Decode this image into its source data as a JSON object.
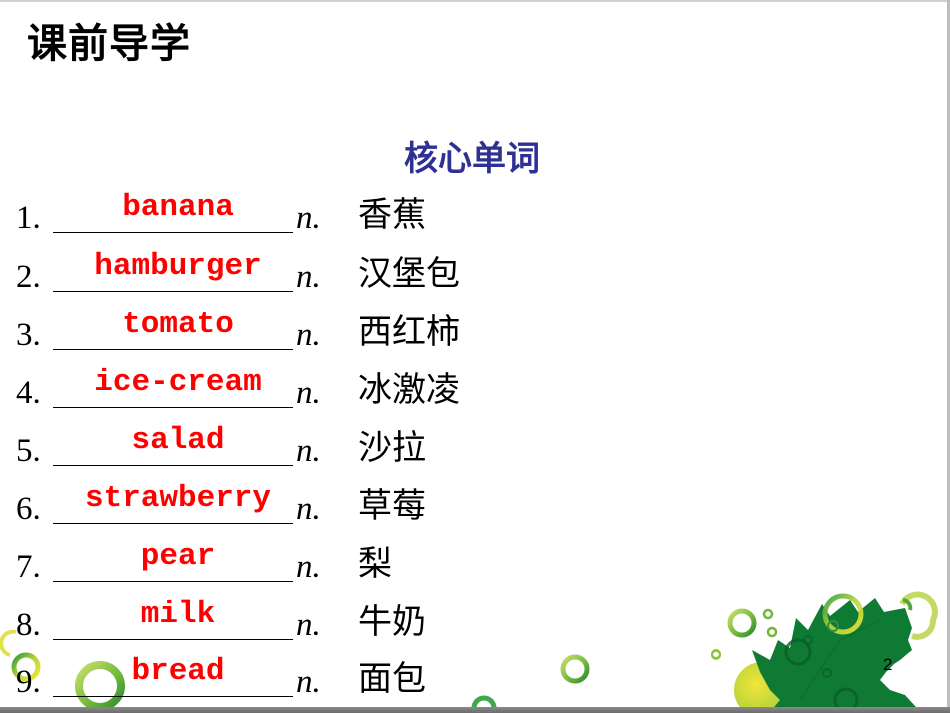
{
  "slide": {
    "title": "课前导学",
    "section_heading": "核心单词",
    "page_number": "2",
    "colors": {
      "title": "#000000",
      "section_heading": "#2e3192",
      "answer": "#ff0000",
      "leaf_dark": "#0e7a33",
      "ring_light": "#a8cf45",
      "ring_yellow": "#e6e332"
    },
    "vocabulary": [
      {
        "number": "1.",
        "answer": "banana",
        "pos": "n.",
        "meaning": "香蕉"
      },
      {
        "number": "2.",
        "answer": "hamburger",
        "pos": "n.",
        "meaning": "汉堡包"
      },
      {
        "number": "3.",
        "answer": "tomato",
        "pos": "n.",
        "meaning": "西红柿"
      },
      {
        "number": "4.",
        "answer": "ice-cream",
        "pos": "n.",
        "meaning": "冰激凌"
      },
      {
        "number": "5.",
        "answer": "salad",
        "pos": "n.",
        "meaning": "沙拉"
      },
      {
        "number": "6.",
        "answer": "strawberry",
        "pos": "n.",
        "meaning": "草莓"
      },
      {
        "number": "7.",
        "answer": "pear",
        "pos": "n.",
        "meaning": "梨"
      },
      {
        "number": "8.",
        "answer": "milk",
        "pos": "n.",
        "meaning": "牛奶"
      },
      {
        "number": "9.",
        "answer": "bread",
        "pos": "n.",
        "meaning": "面包"
      }
    ]
  }
}
